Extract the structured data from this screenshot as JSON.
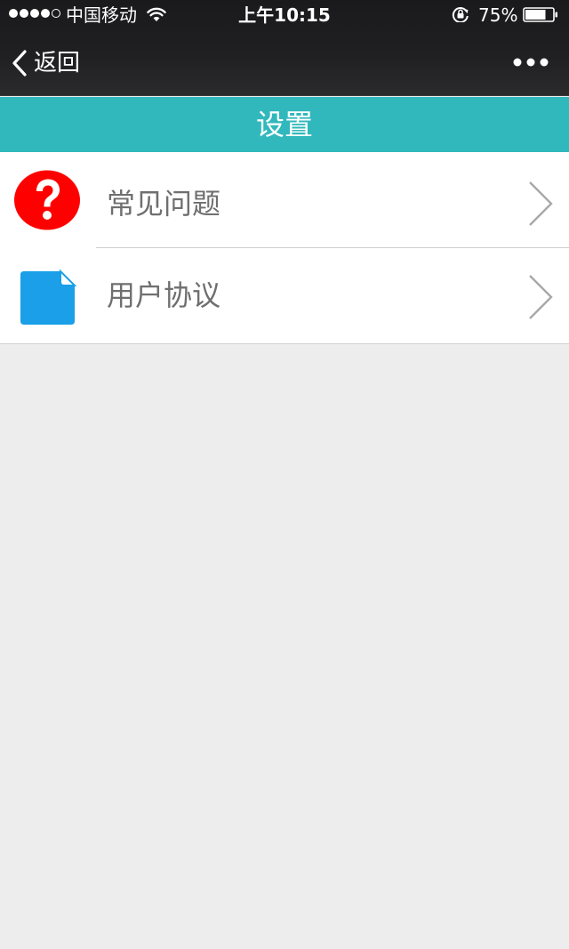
{
  "status_bar": {
    "carrier": "中国移动",
    "time": "上午10:15",
    "battery_percent": "75%",
    "battery_level": 0.75,
    "signal_strength": 4,
    "signal_max": 5
  },
  "nav_bar": {
    "back_label": "返回",
    "more_icon": "more-dots-icon"
  },
  "page": {
    "title": "设置"
  },
  "menu": {
    "items": [
      {
        "label": "常见问题",
        "icon": "help-question-icon",
        "icon_color": "#ff0000"
      },
      {
        "label": "用户协议",
        "icon": "document-icon",
        "icon_color": "#1a9fe8"
      }
    ]
  },
  "colors": {
    "header_bg": "#1d1d1f",
    "title_bar_bg": "#31b8bd",
    "page_bg": "#ededed",
    "item_text": "#6f6f6f"
  }
}
